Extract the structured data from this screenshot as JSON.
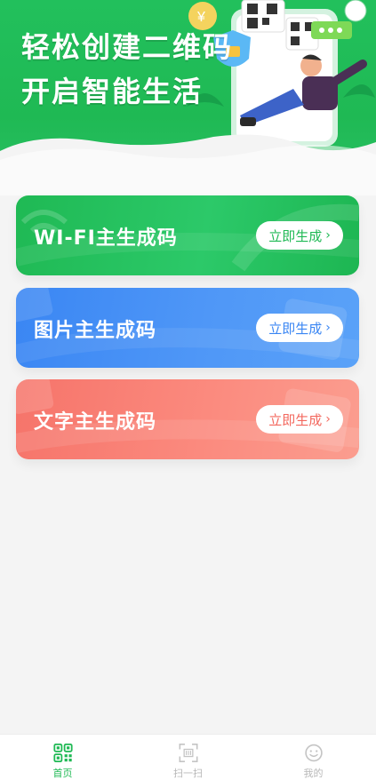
{
  "banner": {
    "headline_line1": "轻松创建二维码",
    "headline_line2": "开启智能生活"
  },
  "cards": {
    "wifi": {
      "title": "WI-FI主生成码",
      "button_label": "立即生成"
    },
    "image": {
      "title": "图片主生成码",
      "button_label": "立即生成"
    },
    "text": {
      "title": "文字主生成码",
      "button_label": "立即生成"
    }
  },
  "tabbar": {
    "home": "首页",
    "scan": "扫一扫",
    "mine": "我的"
  },
  "colors": {
    "brand_green": "#1fb954",
    "card_blue": "#3a86f3",
    "card_red": "#f6746a",
    "inactive_gray": "#b8b8b8"
  },
  "icons": [
    "qr-code-icon",
    "scan-icon",
    "smile-icon",
    "chevron-right-icon",
    "wifi-icon",
    "image-icon",
    "text-icon"
  ]
}
